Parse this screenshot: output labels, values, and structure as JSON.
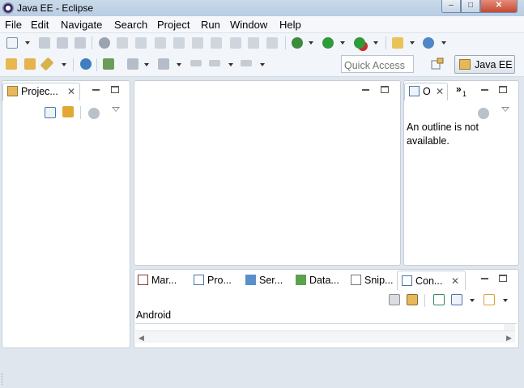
{
  "window": {
    "title": "Java EE - Eclipse"
  },
  "menu": [
    "File",
    "Edit",
    "Navigate",
    "Search",
    "Project",
    "Run",
    "Window",
    "Help"
  ],
  "toolbar": {
    "quick_access_placeholder": "Quick Access",
    "perspective_label": "Java EE"
  },
  "project_explorer": {
    "tab_label": "Projec..."
  },
  "outline": {
    "tab_label": "O",
    "overflow_count": "1",
    "message": "An outline is not available."
  },
  "bottom_tabs": [
    {
      "label": "Mar...",
      "icon": "markers-icon"
    },
    {
      "label": "Pro...",
      "icon": "properties-icon"
    },
    {
      "label": "Ser...",
      "icon": "servers-icon"
    },
    {
      "label": "Data...",
      "icon": "data-source-icon"
    },
    {
      "label": "Snip...",
      "icon": "snippets-icon"
    },
    {
      "label": "Con...",
      "icon": "console-icon",
      "active": true
    }
  ],
  "console": {
    "output": "Android"
  },
  "colors": {
    "accent_green": "#2e9b3a",
    "panel_border": "#c5ced8",
    "workbench_bg": "#dfe6ee"
  }
}
